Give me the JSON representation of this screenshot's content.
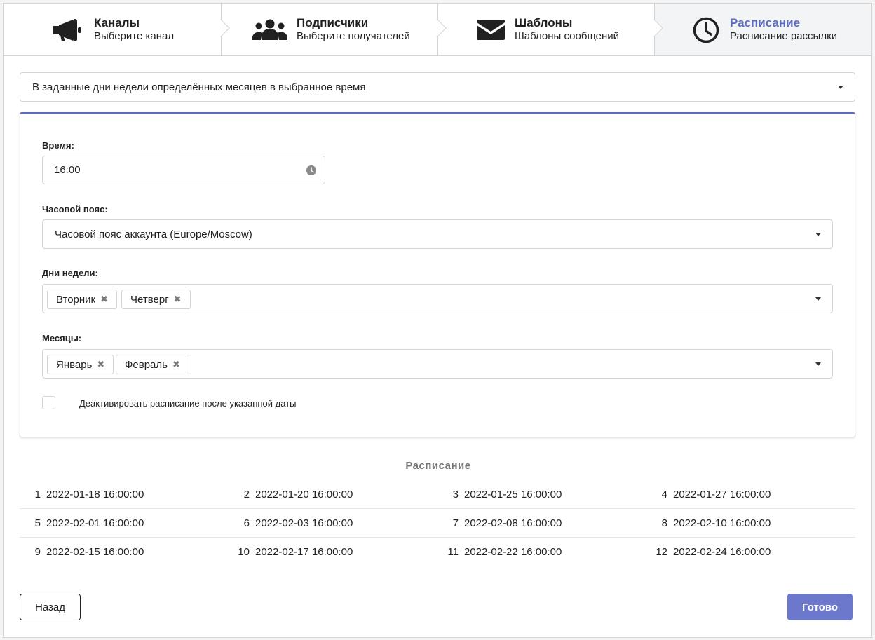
{
  "steps": [
    {
      "title": "Каналы",
      "desc": "Выберите канал",
      "icon": "megaphone-icon"
    },
    {
      "title": "Подписчики",
      "desc": "Выберите получателей",
      "icon": "users-icon"
    },
    {
      "title": "Шаблоны",
      "desc": "Шаблоны сообщений",
      "icon": "envelope-icon"
    },
    {
      "title": "Расписание",
      "desc": "Расписание рассылки",
      "icon": "clock-icon"
    }
  ],
  "schedule_type": {
    "value": "В заданные дни недели определённых месяцев в выбранное время"
  },
  "form": {
    "time_label": "Время:",
    "time_value": "16:00",
    "timezone_label": "Часовой пояс:",
    "timezone_value": "Часовой пояс аккаунта (Europe/Moscow)",
    "weekdays_label": "Дни недели:",
    "weekdays": [
      "Вторник",
      "Четверг"
    ],
    "months_label": "Месяцы:",
    "months": [
      "Январь",
      "Февраль"
    ],
    "remove_glyph": "✖",
    "deactivate_label": "Деактивировать расписание после указанной даты"
  },
  "schedule": {
    "title": "Расписание",
    "rows": [
      [
        {
          "n": "1",
          "d": "2022-01-18 16:00:00"
        },
        {
          "n": "2",
          "d": "2022-01-20 16:00:00"
        },
        {
          "n": "3",
          "d": "2022-01-25 16:00:00"
        },
        {
          "n": "4",
          "d": "2022-01-27 16:00:00"
        }
      ],
      [
        {
          "n": "5",
          "d": "2022-02-01 16:00:00"
        },
        {
          "n": "6",
          "d": "2022-02-03 16:00:00"
        },
        {
          "n": "7",
          "d": "2022-02-08 16:00:00"
        },
        {
          "n": "8",
          "d": "2022-02-10 16:00:00"
        }
      ],
      [
        {
          "n": "9",
          "d": "2022-02-15 16:00:00"
        },
        {
          "n": "10",
          "d": "2022-02-17 16:00:00"
        },
        {
          "n": "11",
          "d": "2022-02-22 16:00:00"
        },
        {
          "n": "12",
          "d": "2022-02-24 16:00:00"
        }
      ]
    ]
  },
  "buttons": {
    "back": "Назад",
    "done": "Готово"
  },
  "colors": {
    "accent": "#5c6bc0",
    "primary_button": "#6c78cc"
  }
}
